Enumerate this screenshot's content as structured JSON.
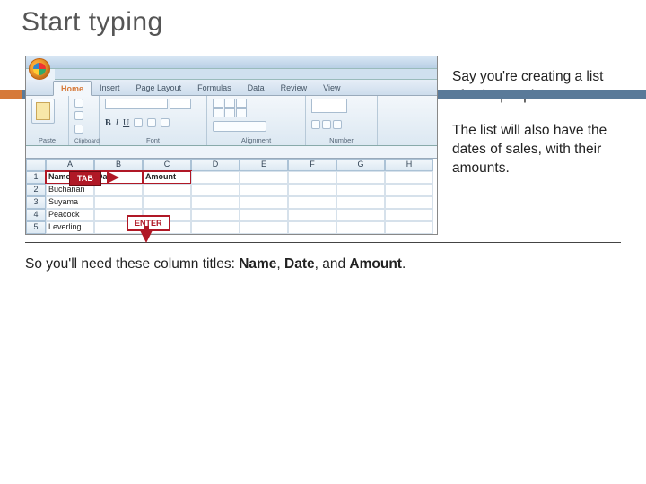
{
  "title": "Start typing",
  "right_paragraph_1": "Say you're creating a list of salespeople names.",
  "right_paragraph_2": "The list will also have the dates of sales, with their amounts.",
  "bottom_prefix": "So you'll need these column titles: ",
  "bottom_b1": "Name",
  "bottom_sep1": ", ",
  "bottom_b2": "Date",
  "bottom_sep2": ", and ",
  "bottom_b3": "Amount",
  "bottom_suffix": ".",
  "excel": {
    "tabs": [
      "Home",
      "Insert",
      "Page Layout",
      "Formulas",
      "Data",
      "Review",
      "View"
    ],
    "groups": {
      "clipboard": "Clipboard",
      "paste": "Paste",
      "font": "Font",
      "alignment": "Alignment",
      "number": "Number"
    },
    "biub": {
      "b": "B",
      "i": "I",
      "u": "U"
    },
    "cols": [
      "A",
      "B",
      "C",
      "D",
      "E",
      "F",
      "G",
      "H"
    ],
    "rows": [
      "1",
      "2",
      "3",
      "4",
      "5"
    ],
    "headers": {
      "c1": "Name",
      "c2": "Date",
      "c3": "Amount"
    },
    "data": [
      "Buchanan",
      "Suyama",
      "Peacock",
      "Leverling"
    ],
    "badges": {
      "tab": "TAB",
      "enter": "ENTER"
    }
  }
}
